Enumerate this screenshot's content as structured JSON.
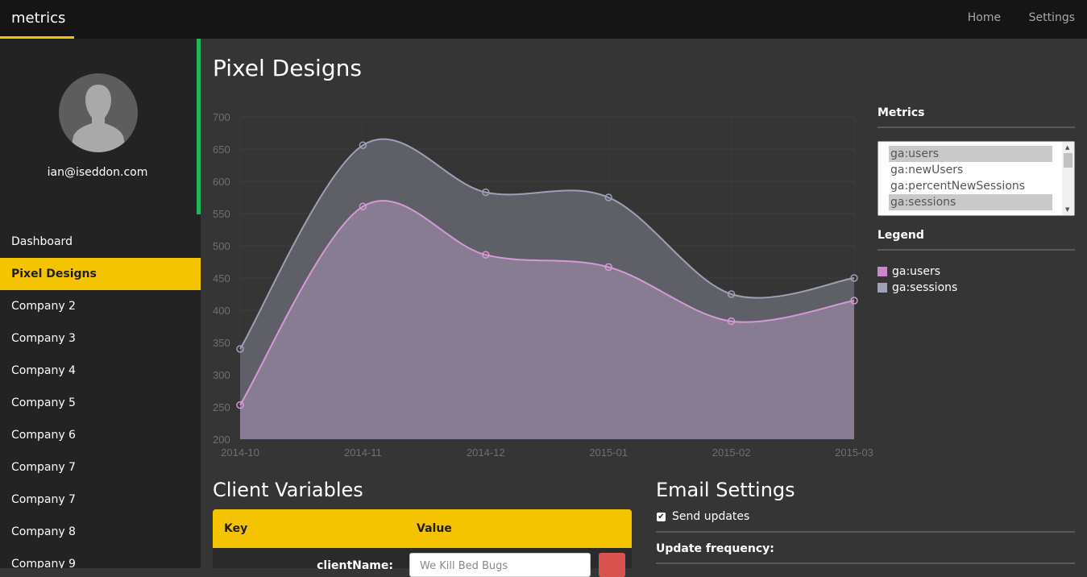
{
  "topbar": {
    "brand": "metrics",
    "nav": [
      "Home",
      "Settings"
    ]
  },
  "user": {
    "email": "ian@iseddon.com"
  },
  "sidebar": {
    "items": [
      {
        "label": "Dashboard",
        "active": false
      },
      {
        "label": "Pixel Designs",
        "active": true
      },
      {
        "label": "Company 2",
        "active": false
      },
      {
        "label": "Company 3",
        "active": false
      },
      {
        "label": "Company 4",
        "active": false
      },
      {
        "label": "Company 5",
        "active": false
      },
      {
        "label": "Company 6",
        "active": false
      },
      {
        "label": "Company 7",
        "active": false
      },
      {
        "label": "Company 7",
        "active": false
      },
      {
        "label": "Company 8",
        "active": false
      },
      {
        "label": "Company 9",
        "active": false
      }
    ]
  },
  "main": {
    "title": "Pixel Designs"
  },
  "chart_data": {
    "type": "area",
    "x": [
      "2014-10",
      "2014-11",
      "2014-12",
      "2015-01",
      "2015-02",
      "2015-03"
    ],
    "ylim": [
      200,
      700
    ],
    "yticks": [
      200,
      250,
      300,
      350,
      400,
      450,
      500,
      550,
      600,
      650,
      700
    ],
    "series": [
      {
        "name": "ga:sessions",
        "values": [
          340,
          656,
          583,
          575,
          425,
          450
        ],
        "color": "#9ea0b7"
      },
      {
        "name": "ga:users",
        "values": [
          253,
          561,
          486,
          467,
          383,
          415
        ],
        "color": "#d49ad6"
      }
    ],
    "title": "",
    "xlabel": "",
    "ylabel": "",
    "grid": true
  },
  "metrics_panel": {
    "heading": "Metrics",
    "options": [
      {
        "label": "ga:users",
        "selected": true
      },
      {
        "label": "ga:newUsers",
        "selected": false
      },
      {
        "label": "ga:percentNewSessions",
        "selected": false
      },
      {
        "label": "ga:sessions",
        "selected": true
      }
    ]
  },
  "legend_panel": {
    "heading": "Legend",
    "entries": [
      {
        "label": "ga:users",
        "color": "#c886cc"
      },
      {
        "label": "ga:sessions",
        "color": "#9ea0b7"
      }
    ]
  },
  "client_variables": {
    "title": "Client Variables",
    "key_header": "Key",
    "value_header": "Value",
    "rows": [
      {
        "key": "clientName:",
        "value": "We Kill Bed Bugs"
      }
    ]
  },
  "email_settings": {
    "title": "Email Settings",
    "send_updates_label": "Send updates",
    "send_updates_checked": true,
    "update_frequency_label": "Update frequency:"
  }
}
